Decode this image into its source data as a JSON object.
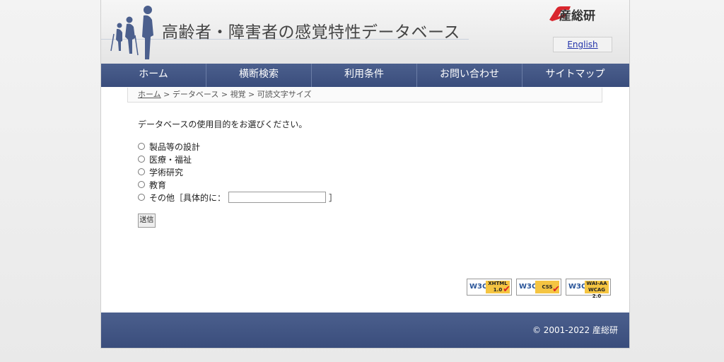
{
  "header": {
    "site_title": "高齢者・障害者の感覚特性データベース",
    "logo_text": "産総研",
    "english_link": "English"
  },
  "nav": {
    "items": [
      {
        "label": "ホーム"
      },
      {
        "label": "横断検索"
      },
      {
        "label": "利用条件"
      },
      {
        "label": "お問い合わせ"
      },
      {
        "label": "サイトマップ"
      }
    ]
  },
  "breadcrumb": {
    "home": "ホーム",
    "sep": " > ",
    "items": [
      "データベース",
      "視覚",
      "可読文字サイズ"
    ]
  },
  "form": {
    "question": "データベースの使用目的をお選びください。",
    "options": [
      {
        "label": "製品等の設計"
      },
      {
        "label": "医療・福祉"
      },
      {
        "label": "学術研究"
      },
      {
        "label": "教育"
      }
    ],
    "other_label": "その他［具体的に：",
    "other_close": "］",
    "other_value": "",
    "submit_label": "送信"
  },
  "badges": [
    {
      "w3c": "W3C",
      "tag": "XHTML 1.0",
      "icon": "check-icon"
    },
    {
      "w3c": "W3C",
      "tag": "CSS",
      "icon": "check-icon"
    },
    {
      "w3c": "W3C",
      "tag": "WAI-AA WCAG 2.0",
      "icon": "none"
    }
  ],
  "footer": {
    "copyright": "© 2001-2022 産総研"
  },
  "colors": {
    "nav_bg": "#3f527f",
    "logo_red": "#d9262e",
    "link_blue": "#2233aa"
  }
}
